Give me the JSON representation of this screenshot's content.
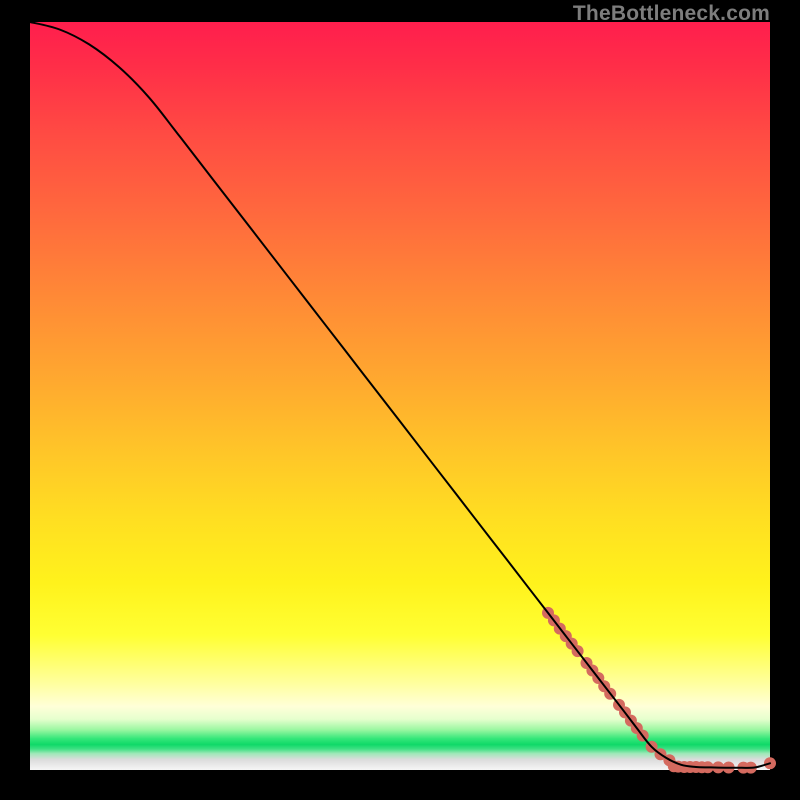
{
  "watermark": "TheBottleneck.com",
  "chart_data": {
    "type": "line",
    "title": "",
    "xlabel": "",
    "ylabel": "",
    "xlim": [
      0,
      100
    ],
    "ylim": [
      0,
      100
    ],
    "grid": false,
    "legend": false,
    "series": [
      {
        "name": "curve",
        "color": "#000000",
        "x": [
          0,
          4,
          8,
          12,
          16,
          20,
          25,
          30,
          35,
          40,
          45,
          50,
          55,
          60,
          65,
          70,
          75,
          80,
          82,
          84,
          86,
          88,
          90,
          92,
          94,
          96,
          98,
          100
        ],
        "y": [
          100,
          99,
          97,
          94,
          90,
          85,
          78.6,
          72.2,
          65.8,
          59.4,
          53.0,
          46.6,
          40.2,
          33.8,
          27.4,
          21.0,
          14.6,
          8.2,
          5.6,
          3.1,
          1.6,
          0.7,
          0.4,
          0.35,
          0.3,
          0.3,
          0.35,
          0.9
        ]
      }
    ],
    "markers": [
      {
        "name": "dots",
        "color": "#d46a5f",
        "radius_px": 6,
        "points": [
          {
            "x": 70.0,
            "y": 21.0
          },
          {
            "x": 70.8,
            "y": 20.0
          },
          {
            "x": 71.6,
            "y": 18.9
          },
          {
            "x": 72.4,
            "y": 17.9
          },
          {
            "x": 73.2,
            "y": 16.9
          },
          {
            "x": 74.0,
            "y": 15.9
          },
          {
            "x": 75.2,
            "y": 14.3
          },
          {
            "x": 76.0,
            "y": 13.3
          },
          {
            "x": 76.8,
            "y": 12.3
          },
          {
            "x": 77.6,
            "y": 11.2
          },
          {
            "x": 78.4,
            "y": 10.2
          },
          {
            "x": 79.6,
            "y": 8.7
          },
          {
            "x": 80.4,
            "y": 7.7
          },
          {
            "x": 81.2,
            "y": 6.6
          },
          {
            "x": 82.0,
            "y": 5.6
          },
          {
            "x": 82.8,
            "y": 4.6
          },
          {
            "x": 84.0,
            "y": 3.1
          },
          {
            "x": 85.2,
            "y": 2.1
          },
          {
            "x": 86.4,
            "y": 1.3
          },
          {
            "x": 87.0,
            "y": 0.5
          },
          {
            "x": 87.6,
            "y": 0.45
          },
          {
            "x": 88.4,
            "y": 0.4
          },
          {
            "x": 89.2,
            "y": 0.4
          },
          {
            "x": 90.0,
            "y": 0.4
          },
          {
            "x": 90.8,
            "y": 0.38
          },
          {
            "x": 91.6,
            "y": 0.36
          },
          {
            "x": 93.0,
            "y": 0.35
          },
          {
            "x": 94.4,
            "y": 0.33
          },
          {
            "x": 96.4,
            "y": 0.32
          },
          {
            "x": 97.4,
            "y": 0.32
          },
          {
            "x": 100.0,
            "y": 0.9
          }
        ]
      }
    ]
  }
}
